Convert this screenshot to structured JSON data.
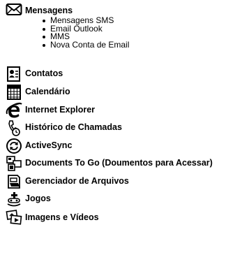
{
  "menu": {
    "items": [
      {
        "label": "Mensagens",
        "icon": "envelope-icon",
        "subitems": [
          "Mensagens SMS",
          "Email Outlook",
          "MMS",
          "Nova Conta de Email"
        ]
      },
      {
        "label": "Contatos",
        "icon": "contacts-card-icon"
      },
      {
        "label": "Calendário",
        "icon": "calendar-icon"
      },
      {
        "label": "Internet Explorer",
        "icon": "internet-explorer-icon"
      },
      {
        "label": "Histórico de Chamadas",
        "icon": "call-history-icon"
      },
      {
        "label": "ActiveSync",
        "icon": "activesync-icon"
      },
      {
        "label": "Documents To Go (Doumentos para Acessar)",
        "icon": "documents-to-go-icon"
      },
      {
        "label": "Gerenciador de Arquivos",
        "icon": "file-manager-icon"
      },
      {
        "label": "Jogos",
        "icon": "games-icon"
      },
      {
        "label": "Imagens e Vídeos",
        "icon": "images-videos-icon"
      }
    ]
  }
}
